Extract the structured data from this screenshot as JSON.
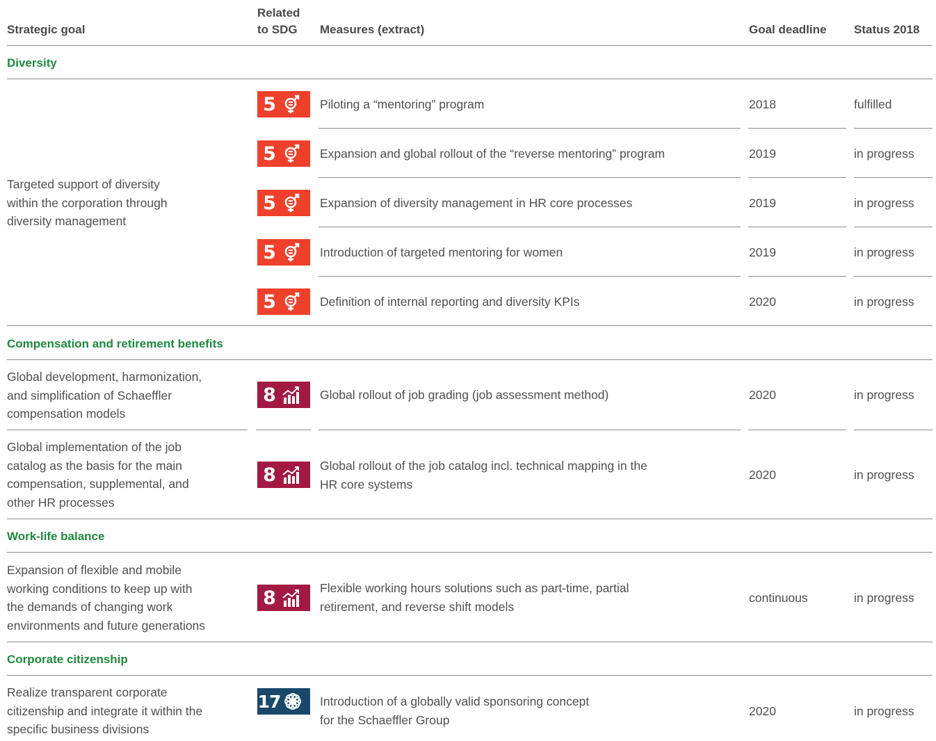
{
  "header": {
    "strategic_goal": "Strategic goal",
    "sdg_line1": "Related",
    "sdg_line2": "to SDG",
    "measures": "Measures (extract)",
    "deadline": "Goal deadline",
    "status": "Status 2018"
  },
  "sections": {
    "diversity": {
      "title": "Diversity",
      "goal": [
        "Targeted support of diversity",
        "within the corporation through",
        "diversity management"
      ],
      "rows": [
        {
          "sdg": "5",
          "measure": "Piloting a “mentoring” program",
          "deadline": "2018",
          "status": "fulfilled"
        },
        {
          "sdg": "5",
          "measure": "Expansion and global rollout of the “reverse mentoring” program",
          "deadline": "2019",
          "status": "in progress"
        },
        {
          "sdg": "5",
          "measure": "Expansion of diversity management in HR core processes",
          "deadline": "2019",
          "status": "in progress"
        },
        {
          "sdg": "5",
          "measure": "Introduction of targeted mentoring for women",
          "deadline": "2019",
          "status": "in progress"
        },
        {
          "sdg": "5",
          "measure": "Definition of internal reporting and diversity KPIs",
          "deadline": "2020",
          "status": "in progress"
        }
      ]
    },
    "compensation": {
      "title": "Compensation and retirement benefits",
      "rows": [
        {
          "goal": [
            "Global development, harmonization,",
            "and simplification of Schaeffler",
            "compensation models"
          ],
          "sdg": "8",
          "measure": [
            "Global rollout of job grading (job assessment method)"
          ],
          "deadline": "2020",
          "status": "in progress"
        },
        {
          "goal": [
            "Global implementation of the job",
            "catalog as the basis for the main",
            "compensation, supplemental, and",
            "other HR processes"
          ],
          "sdg": "8",
          "measure": [
            "Global rollout of the job catalog incl. technical mapping in the",
            "HR core systems"
          ],
          "deadline": "2020",
          "status": "in progress"
        }
      ]
    },
    "worklife": {
      "title": "Work-life balance",
      "rows": [
        {
          "goal": [
            "Expansion of flexible and mobile",
            "working conditions to keep up with",
            "the demands of changing work",
            "environments and future generations"
          ],
          "sdg": "8",
          "measure": [
            "Flexible working hours solutions such as part-time, partial",
            "retirement, and reverse shift models"
          ],
          "deadline": "continuous",
          "status": "in progress"
        }
      ]
    },
    "citizenship": {
      "title": "Corporate citizenship",
      "rows": [
        {
          "goal": [
            "Realize transparent corporate",
            "citizenship and integrate it within the",
            "specific business divisions"
          ],
          "sdg": "17",
          "measure": [
            "Introduction of a globally valid sponsoring concept",
            "for the Schaeffler Group"
          ],
          "deadline": "2020",
          "status": "in progress"
        }
      ]
    }
  },
  "colors": {
    "section_title": "#1e8a3c",
    "sdg5": "#ef402b",
    "sdg8": "#a21942",
    "sdg17": "#19486a"
  },
  "icons": {
    "sdg5": "gender-equality-icon",
    "sdg8": "economic-growth-icon",
    "sdg17": "partnerships-icon"
  }
}
